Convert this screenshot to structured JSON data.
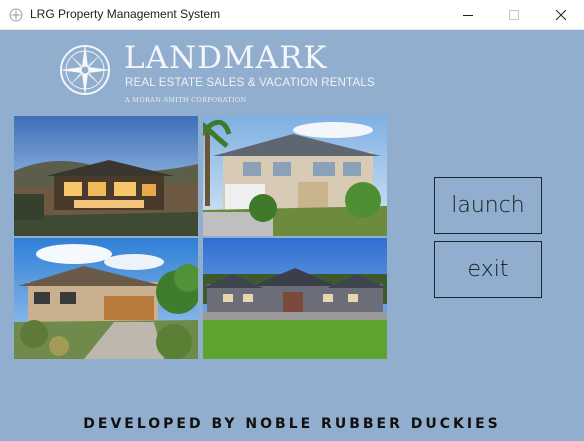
{
  "window": {
    "title": "LRG Property Management System",
    "controls": [
      "minimize",
      "maximize",
      "close"
    ]
  },
  "logo": {
    "brand": "LANDMARK",
    "tagline": "REAL ESTATE SALES & VACATION RENTALS",
    "subtag": "A MORAN-SMITH CORPORATION"
  },
  "photos": [
    {
      "name": "modern-hillside-home-at-dusk"
    },
    {
      "name": "two-story-house-with-palm-tree"
    },
    {
      "name": "craftsman-house-with-garage"
    },
    {
      "name": "large-estate-with-lawn"
    }
  ],
  "buttons": {
    "launch": "launch",
    "exit": "exit"
  },
  "footer": {
    "text": "DEVELOPED BY NOBLE RUBBER DUCKIES"
  },
  "colors": {
    "background": "#91aecf",
    "titlebar": "#ffffff",
    "button_border": "#1d2733"
  }
}
